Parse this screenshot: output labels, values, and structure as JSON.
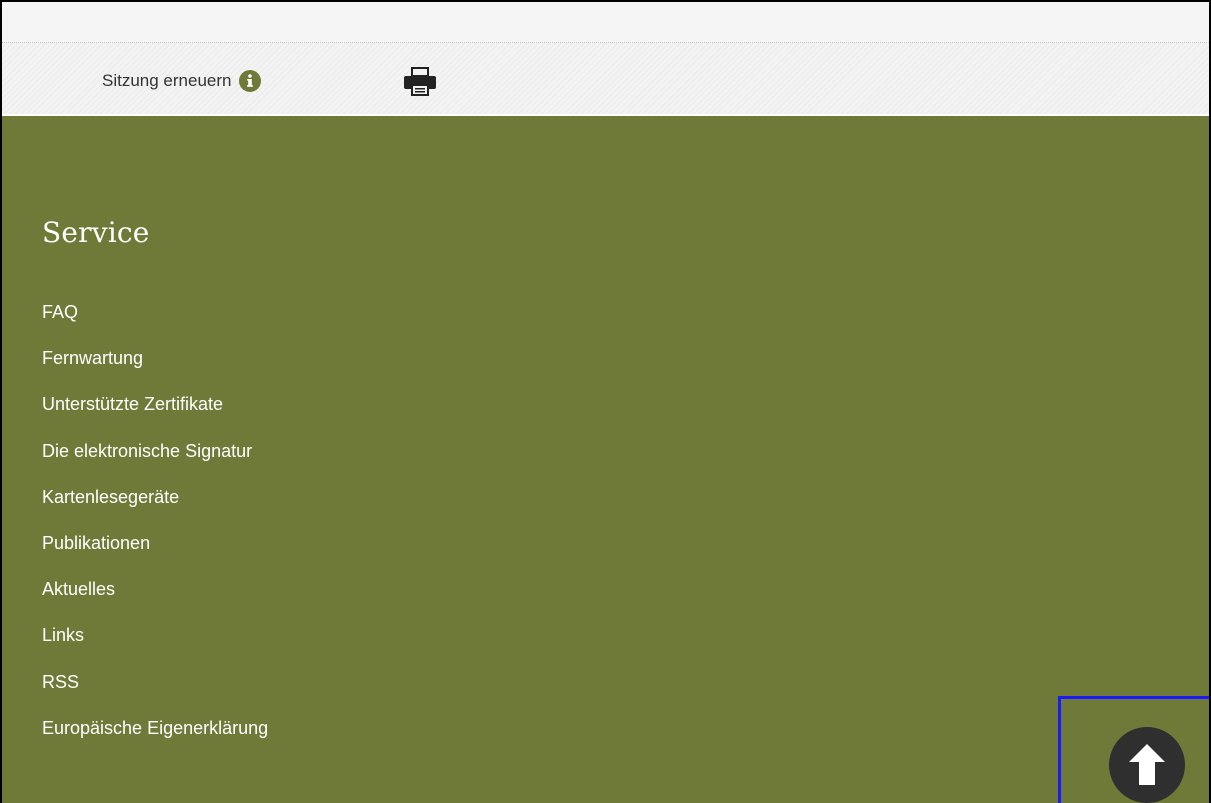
{
  "header": {
    "session_label": "Sitzung erneuern",
    "info_icon": "info-circle-icon",
    "print_icon": "printer-icon"
  },
  "footer": {
    "title": "Service",
    "links": [
      {
        "label": "FAQ"
      },
      {
        "label": "Fernwartung"
      },
      {
        "label": "Unterstützte Zertifikate"
      },
      {
        "label": "Die elektronische Signatur"
      },
      {
        "label": "Kartenlesegeräte"
      },
      {
        "label": "Publikationen"
      },
      {
        "label": "Aktuelles"
      },
      {
        "label": "Links"
      },
      {
        "label": "RSS"
      },
      {
        "label": "Europäische Eigenerklärung"
      }
    ],
    "scroll_top_icon": "arrow-up-circle-icon"
  },
  "colors": {
    "footer_background": "#6f7a39",
    "header_background": "#f3f3f3",
    "highlight_border": "#1a1aff",
    "icon_dark": "#2f2f2f"
  }
}
